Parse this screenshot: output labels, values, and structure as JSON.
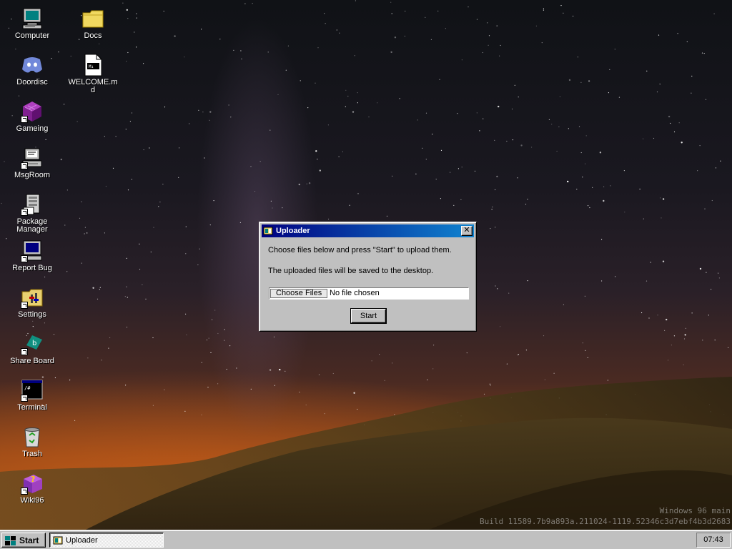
{
  "desktop": {
    "watermark_line1": "Windows 96 main",
    "watermark_line2": "Build 11589.7b9a893a.211024-1119.52346c3d7ebf4b3d2683",
    "icons": [
      {
        "label": "Computer",
        "icon": "computer-icon"
      },
      {
        "label": "Docs",
        "icon": "folder-icon"
      },
      {
        "label": "Doordisc",
        "icon": "chat-app-icon"
      },
      {
        "label": "WELCOME.md",
        "icon": "markdown-file-icon"
      },
      {
        "label": "Gameing",
        "icon": "game-cube-icon"
      },
      {
        "label": "MsgRoom",
        "icon": "message-room-icon"
      },
      {
        "label": "Package Manager",
        "icon": "package-manager-icon"
      },
      {
        "label": "Report Bug",
        "icon": "report-bug-icon"
      },
      {
        "label": "Settings",
        "icon": "settings-folder-icon"
      },
      {
        "label": "Share Board",
        "icon": "share-board-icon"
      },
      {
        "label": "Terminal",
        "icon": "terminal-icon"
      },
      {
        "label": "Trash",
        "icon": "recycle-bin-icon"
      },
      {
        "label": "Wiki96",
        "icon": "help-book-icon"
      }
    ]
  },
  "window": {
    "title": "Uploader",
    "close_label": "✕",
    "message1": "Choose files below and press \"Start\" to upload them.",
    "message2": "The uploaded files will be saved to the desktop.",
    "choose_files_label": "Choose Files",
    "no_file_text": "No file chosen",
    "start_label": "Start"
  },
  "taskbar": {
    "start_label": "Start",
    "task_label": "Uploader",
    "clock": "07:43"
  },
  "colors": {
    "titlebar_start": "#000080",
    "titlebar_end": "#1084d0",
    "face": "#c0c0c0"
  }
}
